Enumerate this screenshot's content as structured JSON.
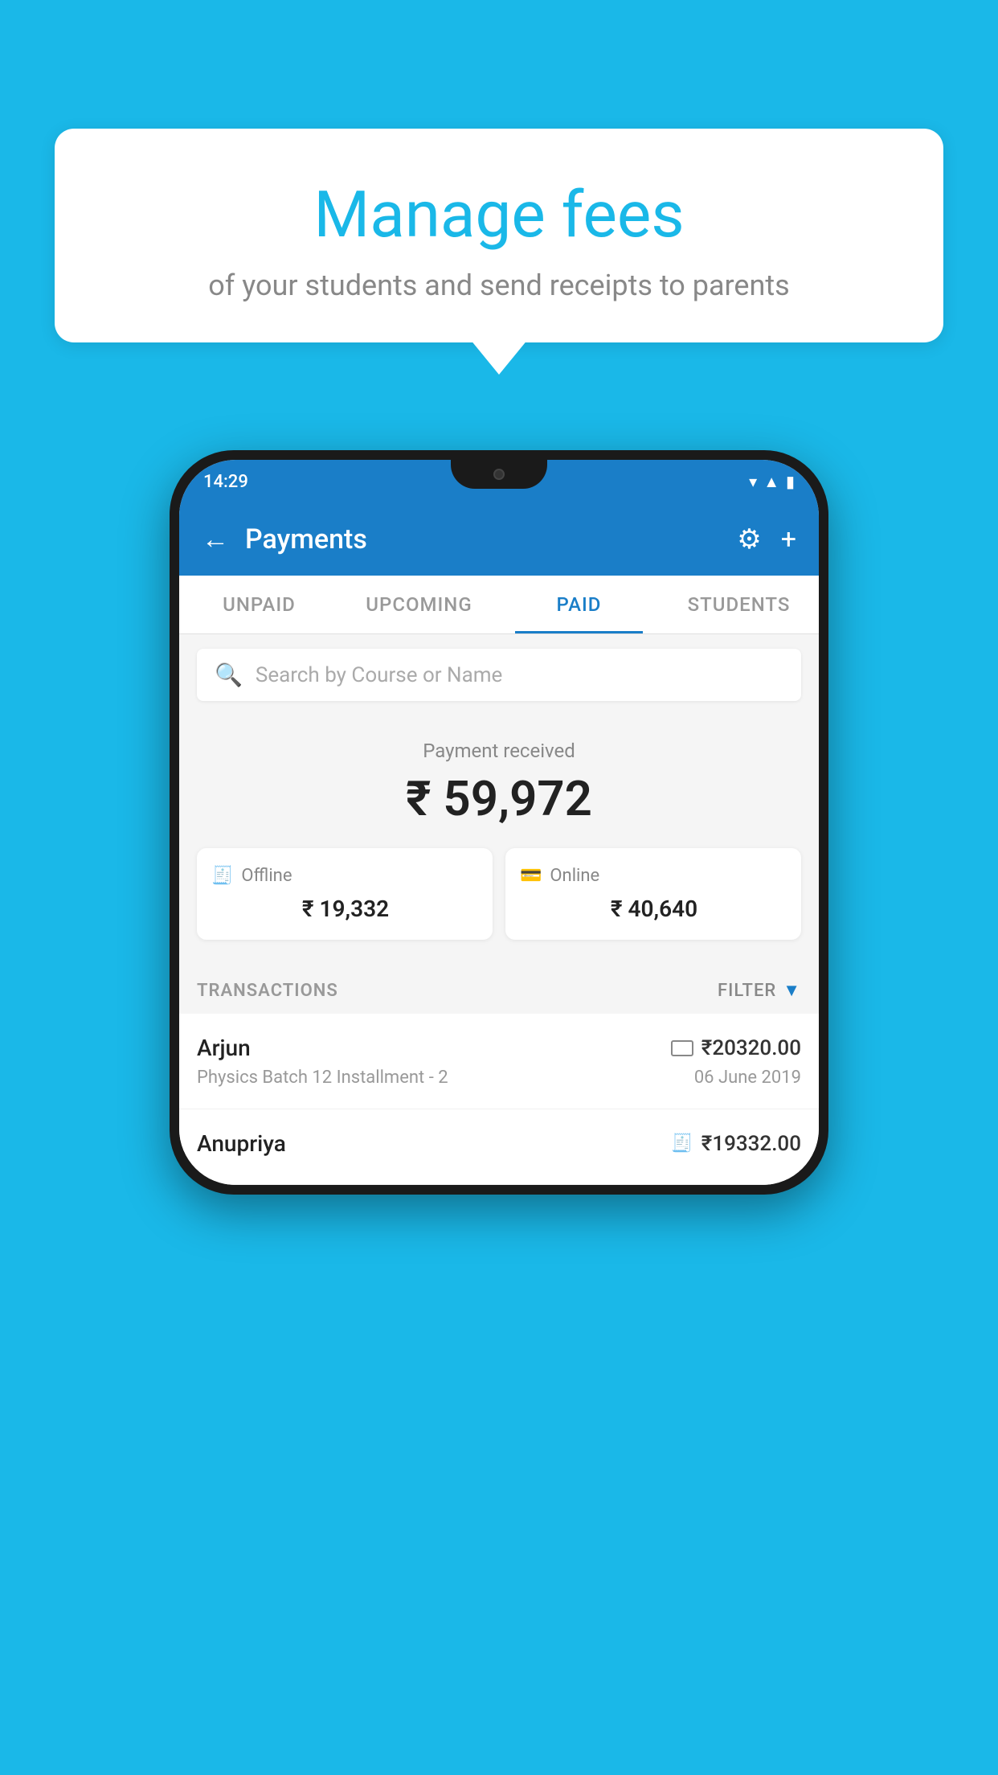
{
  "background_color": "#1AB8E8",
  "speech_bubble": {
    "title": "Manage fees",
    "subtitle": "of your students and send receipts to parents"
  },
  "phone": {
    "status_bar": {
      "time": "14:29",
      "icons": [
        "wifi",
        "signal",
        "battery"
      ]
    },
    "app_bar": {
      "title": "Payments",
      "back_label": "←",
      "settings_label": "⚙",
      "add_label": "+"
    },
    "tabs": [
      {
        "label": "UNPAID",
        "active": false
      },
      {
        "label": "UPCOMING",
        "active": false
      },
      {
        "label": "PAID",
        "active": true
      },
      {
        "label": "STUDENTS",
        "active": false
      }
    ],
    "search": {
      "placeholder": "Search by Course or Name"
    },
    "payment_summary": {
      "label": "Payment received",
      "total": "₹ 59,972",
      "offline": {
        "label": "Offline",
        "amount": "₹ 19,332"
      },
      "online": {
        "label": "Online",
        "amount": "₹ 40,640"
      }
    },
    "transactions": {
      "header_label": "TRANSACTIONS",
      "filter_label": "FILTER",
      "items": [
        {
          "name": "Arjun",
          "description": "Physics Batch 12 Installment - 2",
          "amount": "₹20320.00",
          "date": "06 June 2019",
          "payment_type": "online"
        },
        {
          "name": "Anupriya",
          "description": "",
          "amount": "₹19332.00",
          "date": "",
          "payment_type": "offline"
        }
      ]
    }
  }
}
